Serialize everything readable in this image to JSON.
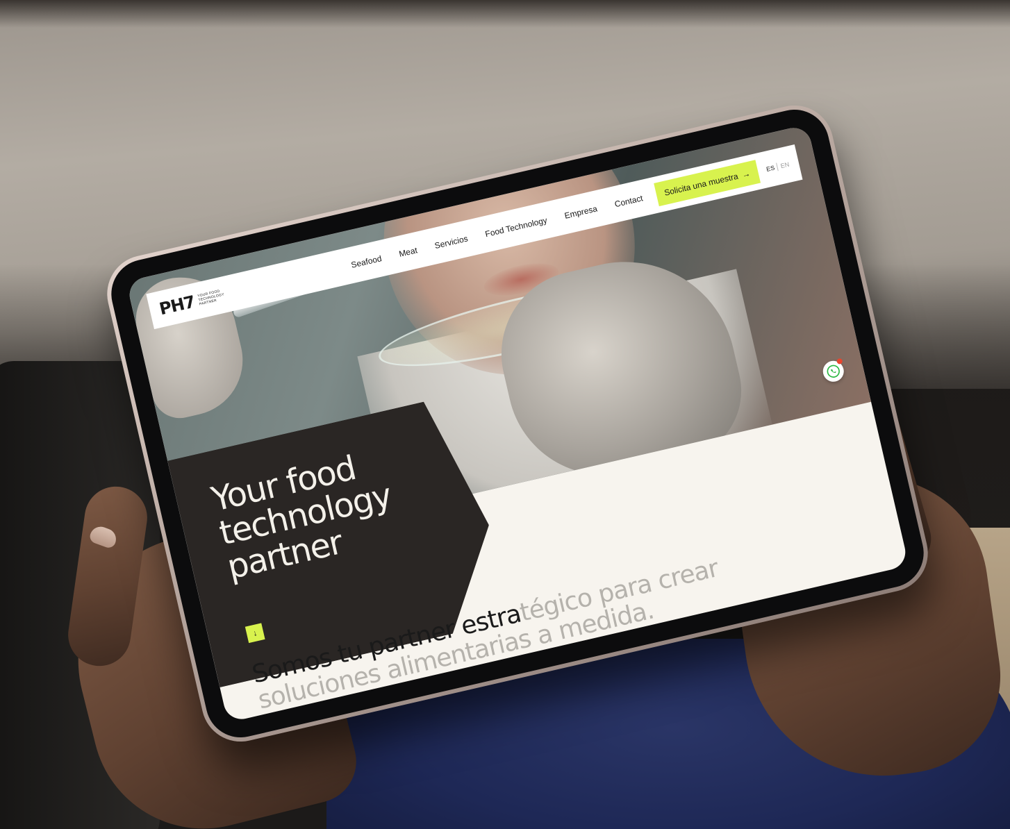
{
  "site": {
    "logo": "PH7",
    "logo_tagline": [
      "YOUR FOOD",
      "TECHNOLOGY",
      "PARTNER"
    ],
    "nav": [
      "Seafood",
      "Meat",
      "Servicios",
      "Food Technology",
      "Empresa",
      "Contact"
    ],
    "cta_label": "Solicita una muestra",
    "cta_arrow": "→",
    "lang_active": "ES",
    "lang_inactive": "EN",
    "hero_title": "Your food technology partner",
    "scroll_arrow": "↓",
    "statement_strong": "Somos tu partner estra",
    "statement_soft": "tégico para crear soluciones alimentarias a medida.",
    "whatsapp_icon": "whatsapp-icon"
  },
  "colors": {
    "accent": "#d8f24e",
    "dark_card": "#2a2624",
    "page_bg": "#f7f4ee",
    "soft_text": "#b5b2ac"
  }
}
